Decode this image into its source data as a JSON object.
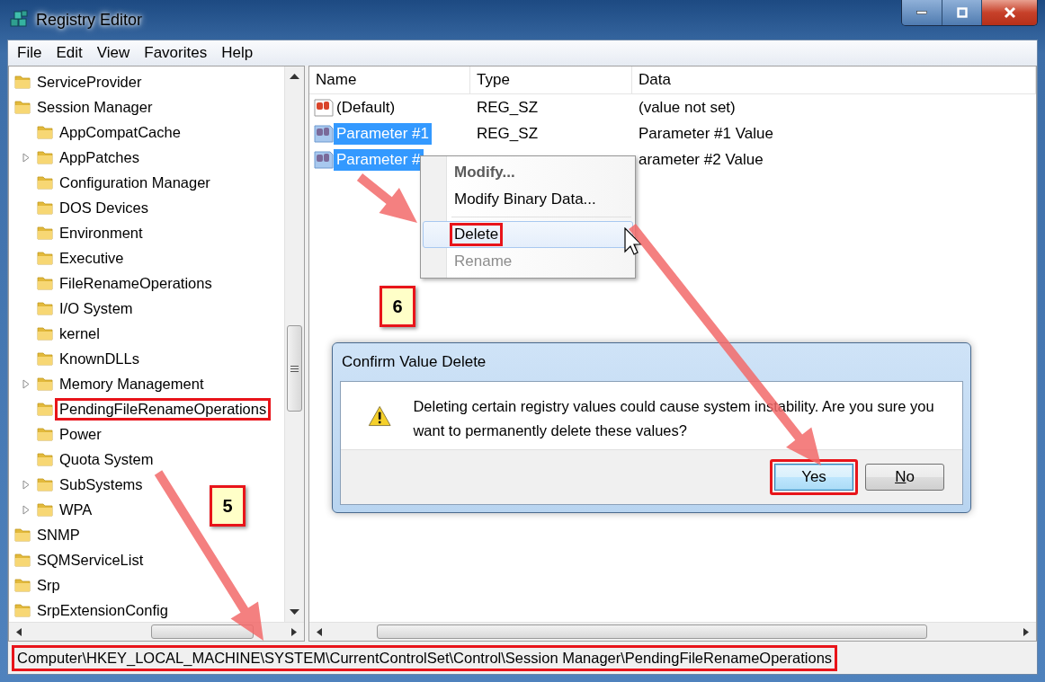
{
  "window": {
    "title": "Registry Editor"
  },
  "menu": [
    "File",
    "Edit",
    "View",
    "Favorites",
    "Help"
  ],
  "tree": [
    {
      "label": "ServiceProvider",
      "highlighted": false
    },
    {
      "label": "Session Manager",
      "highlighted": false,
      "children": [
        {
          "label": "AppCompatCache",
          "expandable": false,
          "highlighted": false
        },
        {
          "label": "AppPatches",
          "expandable": true,
          "highlighted": false
        },
        {
          "label": "Configuration Manager",
          "expandable": false,
          "highlighted": false
        },
        {
          "label": "DOS Devices",
          "expandable": false,
          "highlighted": false
        },
        {
          "label": "Environment",
          "expandable": false,
          "highlighted": false
        },
        {
          "label": "Executive",
          "expandable": false,
          "highlighted": false
        },
        {
          "label": "FileRenameOperations",
          "expandable": false,
          "highlighted": false
        },
        {
          "label": "I/O System",
          "expandable": false,
          "highlighted": false
        },
        {
          "label": "kernel",
          "expandable": false,
          "highlighted": false
        },
        {
          "label": "KnownDLLs",
          "expandable": false,
          "highlighted": false
        },
        {
          "label": "Memory Management",
          "expandable": true,
          "highlighted": false
        },
        {
          "label": "PendingFileRenameOperations",
          "expandable": false,
          "highlighted": true
        },
        {
          "label": "Power",
          "expandable": false,
          "highlighted": false
        },
        {
          "label": "Quota System",
          "expandable": false,
          "highlighted": false
        },
        {
          "label": "SubSystems",
          "expandable": true,
          "highlighted": false
        },
        {
          "label": "WPA",
          "expandable": true,
          "highlighted": false
        }
      ]
    },
    {
      "label": "SNMP",
      "highlighted": false
    },
    {
      "label": "SQMServiceList",
      "highlighted": false
    },
    {
      "label": "Srp",
      "highlighted": false
    },
    {
      "label": "SrpExtensionConfig",
      "highlighted": false
    }
  ],
  "list": {
    "columns": [
      "Name",
      "Type",
      "Data"
    ],
    "rows": [
      {
        "kind": "default",
        "name": "(Default)",
        "type": "REG_SZ",
        "data": "(value not set)",
        "selected": false
      },
      {
        "kind": "string",
        "name": "Parameter #1",
        "type": "REG_SZ",
        "data": "Parameter #1 Value",
        "selected": true
      },
      {
        "kind": "string",
        "name": "Parameter #",
        "data": "arameter #2 Value",
        "selected": true
      }
    ]
  },
  "context_menu": {
    "items": [
      {
        "kind": "item",
        "label": "Modify...",
        "default": true,
        "disabled": false,
        "hovered": false,
        "highlighted": false
      },
      {
        "kind": "item",
        "label": "Modify Binary Data...",
        "default": false,
        "disabled": false,
        "hovered": false,
        "highlighted": false
      },
      {
        "kind": "separator"
      },
      {
        "kind": "item",
        "label": "Delete",
        "default": false,
        "disabled": false,
        "hovered": true,
        "highlighted": true
      },
      {
        "kind": "item",
        "label": "Rename",
        "default": false,
        "disabled": true,
        "hovered": false,
        "highlighted": false
      }
    ]
  },
  "dialog": {
    "title": "Confirm Value Delete",
    "message": "Deleting certain registry values could cause system instability. Are you sure you want to permanently delete these values?",
    "buttons": [
      {
        "label": "Yes",
        "default": true,
        "underline_first": false,
        "highlighted": true
      },
      {
        "label": "No",
        "default": false,
        "underline_first": true,
        "highlighted": false
      }
    ]
  },
  "status_bar": {
    "path": "Computer\\HKEY_LOCAL_MACHINE\\SYSTEM\\CurrentControlSet\\Control\\Session Manager\\PendingFileRenameOperations",
    "highlighted": true
  },
  "callouts": [
    {
      "label": "6"
    },
    {
      "label": "5"
    }
  ]
}
